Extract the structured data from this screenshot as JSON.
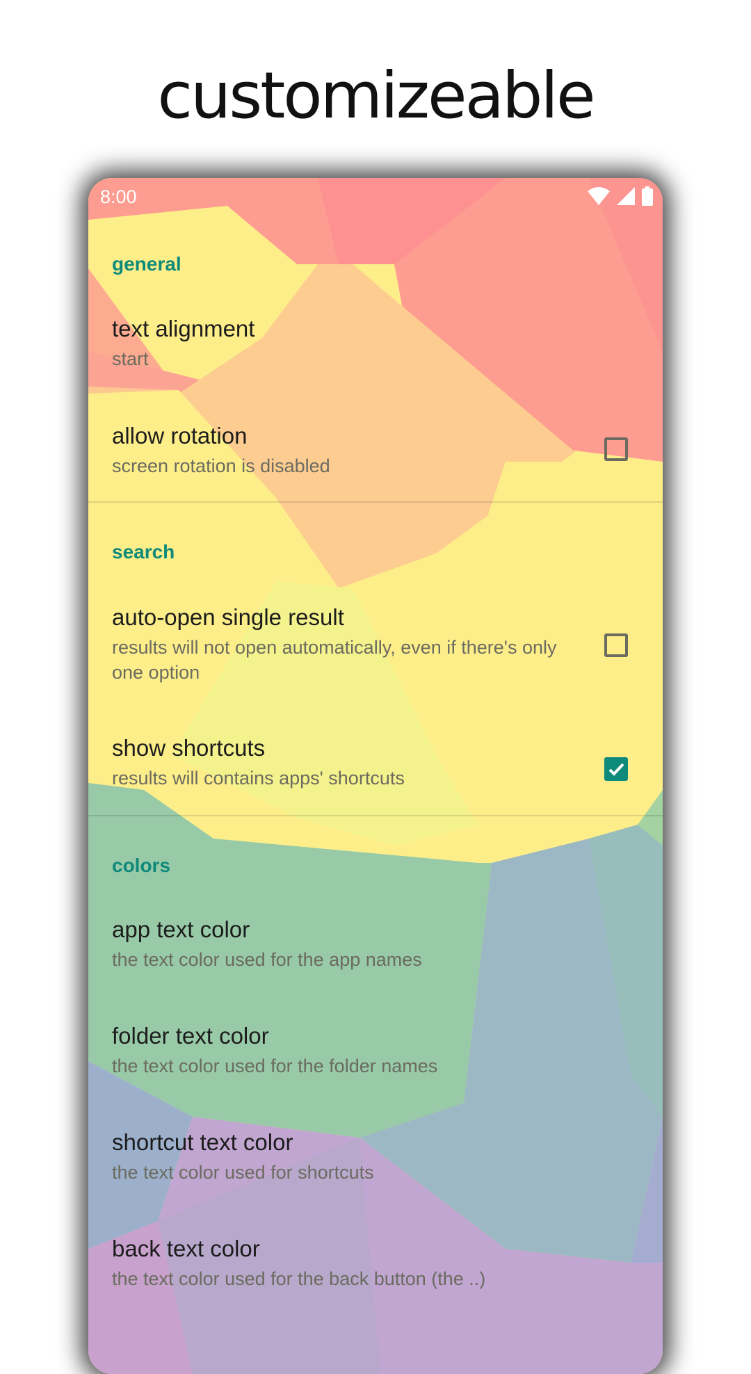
{
  "headline": "customizeable",
  "status_bar": {
    "time": "8:00",
    "icons": [
      "wifi-icon",
      "signal-icon",
      "battery-icon"
    ]
  },
  "sections": {
    "general": "general",
    "search": "search",
    "colors": "colors"
  },
  "prefs": {
    "text_alignment": {
      "title": "text alignment",
      "summary": "start"
    },
    "allow_rotation": {
      "title": "allow rotation",
      "summary": "screen rotation is disabled",
      "checked": false
    },
    "auto_open": {
      "title": "auto-open single result",
      "summary": "results will not open automatically, even if there's only one option",
      "checked": false
    },
    "show_shortcuts": {
      "title": "show shortcuts",
      "summary": "results will contains apps' shortcuts",
      "checked": true
    },
    "app_text_color": {
      "title": "app text color",
      "summary": "the text color used for the app names"
    },
    "folder_text_color": {
      "title": "folder text color",
      "summary": "the text color used for the folder names"
    },
    "shortcut_text_color": {
      "title": "shortcut text color",
      "summary": "the text color used for shortcuts"
    },
    "back_text_color": {
      "title": "back text color",
      "summary": "the text color used for the back button (the ..)"
    }
  },
  "colors": {
    "accent": "#0e8a7a",
    "title_text": "#1c1c1c",
    "summary_text": "#6b6b60",
    "bg_red": "#fd9c90",
    "bg_orange": "#fdcc90",
    "bg_yellow": "#fdee8a",
    "bg_green": "#98caa8",
    "bg_blue": "#9cb8c4",
    "bg_purple": "#c0a6d0"
  }
}
